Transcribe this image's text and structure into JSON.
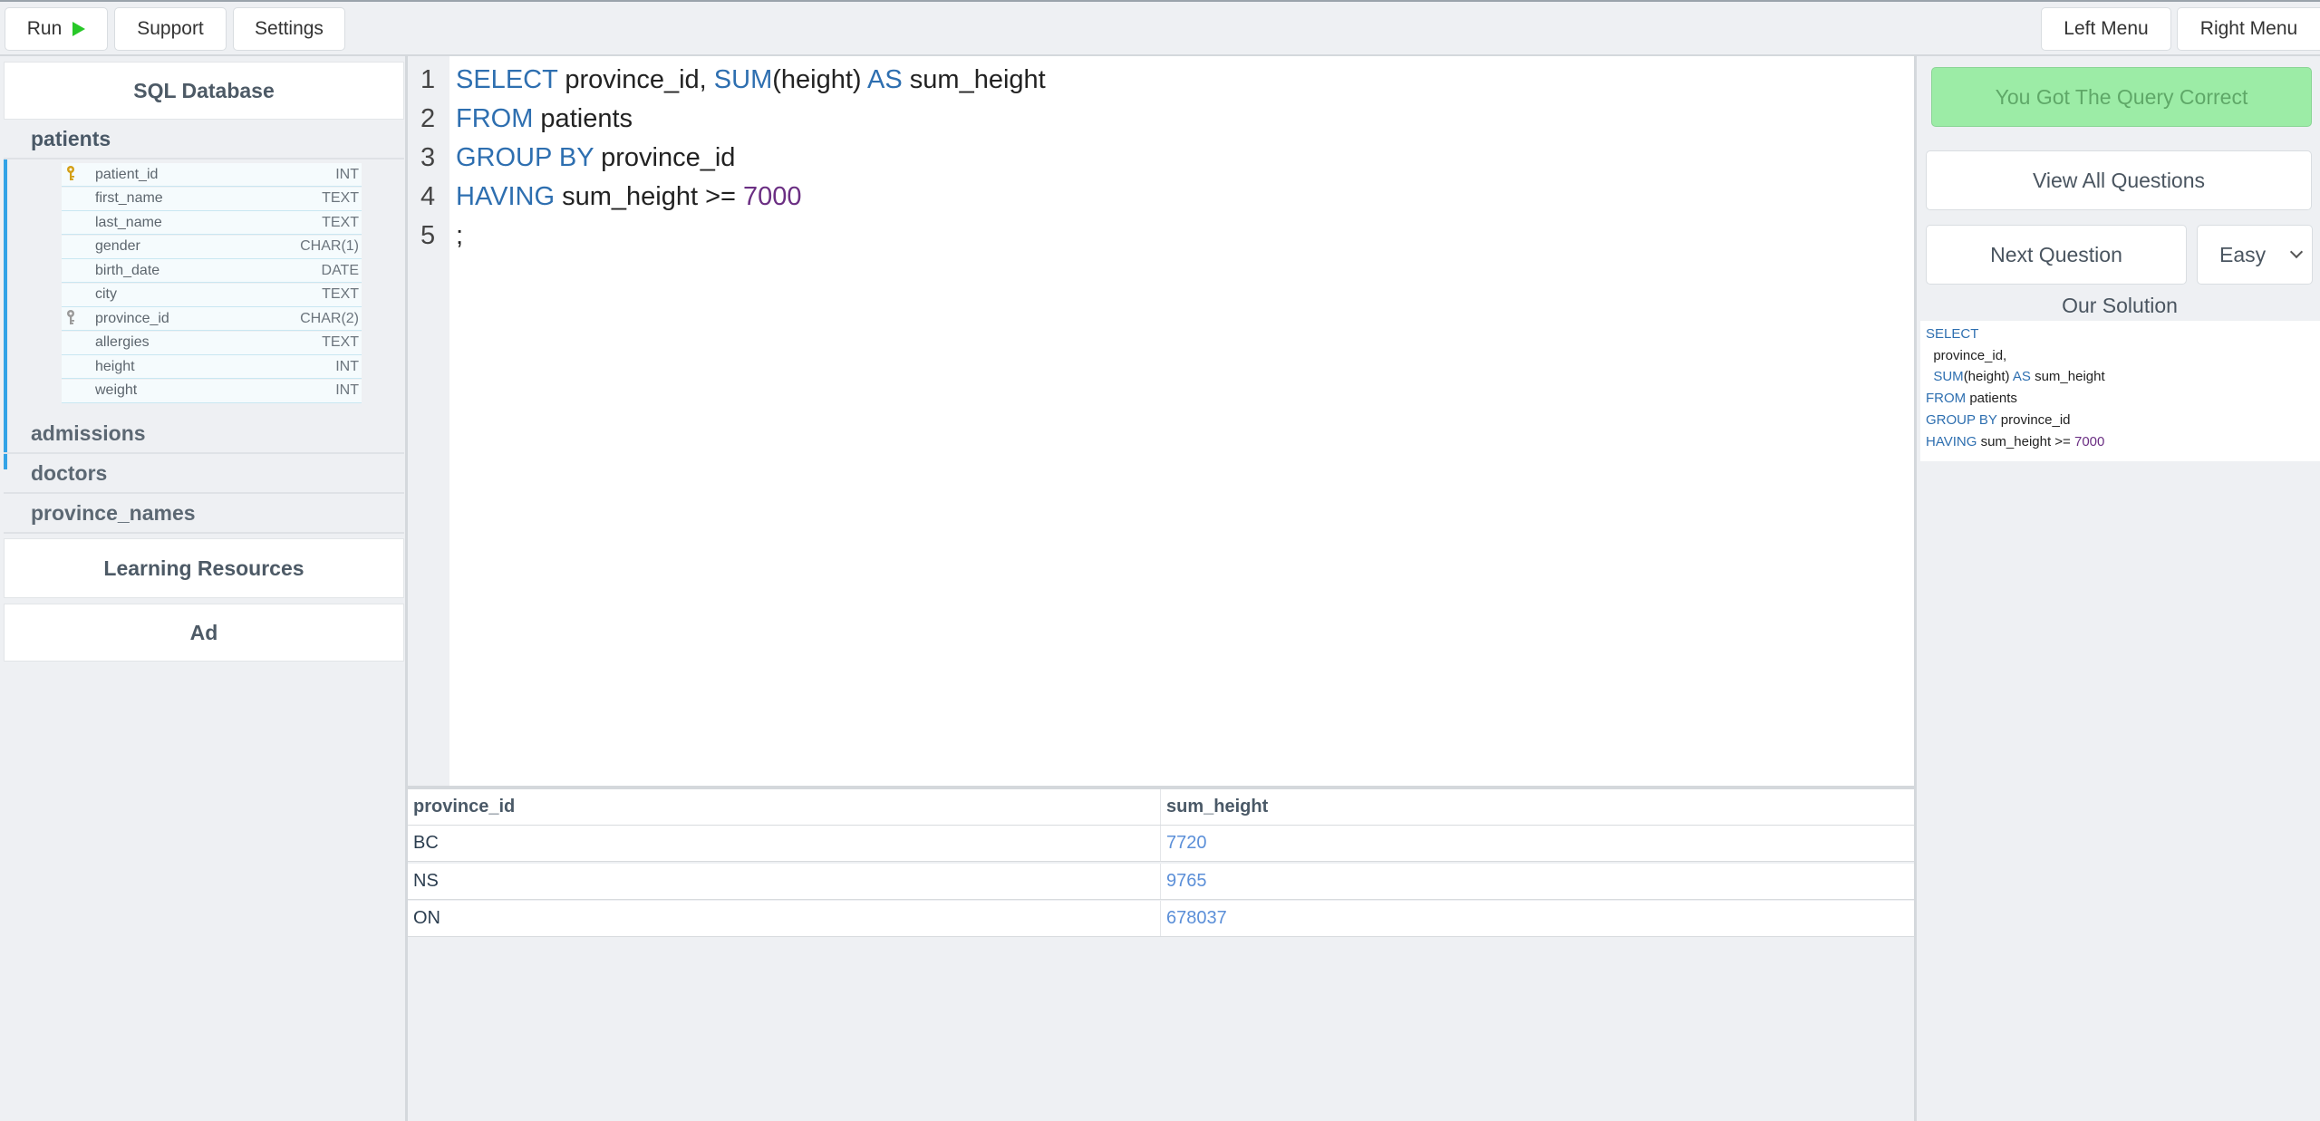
{
  "toolbar": {
    "run_label": "Run",
    "support_label": "Support",
    "settings_label": "Settings",
    "left_menu_label": "Left Menu",
    "right_menu_label": "Right Menu"
  },
  "sidebar": {
    "db_title": "SQL Database",
    "tables": [
      {
        "name": "patients",
        "open": true
      },
      {
        "name": "admissions",
        "open": false
      },
      {
        "name": "doctors",
        "open": false
      },
      {
        "name": "province_names",
        "open": false
      }
    ],
    "columns": [
      {
        "name": "patient_id",
        "type": "INT",
        "key": "primary"
      },
      {
        "name": "first_name",
        "type": "TEXT"
      },
      {
        "name": "last_name",
        "type": "TEXT"
      },
      {
        "name": "gender",
        "type": "CHAR(1)"
      },
      {
        "name": "birth_date",
        "type": "DATE"
      },
      {
        "name": "city",
        "type": "TEXT"
      },
      {
        "name": "province_id",
        "type": "CHAR(2)",
        "key": "foreign"
      },
      {
        "name": "allergies",
        "type": "TEXT"
      },
      {
        "name": "height",
        "type": "INT"
      },
      {
        "name": "weight",
        "type": "INT"
      }
    ],
    "learning_resources_label": "Learning Resources",
    "ad_label": "Ad"
  },
  "editor": {
    "line_numbers": [
      "1",
      "2",
      "3",
      "4",
      "5"
    ],
    "lines": [
      [
        {
          "t": "SELECT",
          "c": "kw"
        },
        {
          "t": " province_id, "
        },
        {
          "t": "SUM",
          "c": "kw"
        },
        {
          "t": "(height) "
        },
        {
          "t": "AS",
          "c": "kw"
        },
        {
          "t": " sum_height"
        }
      ],
      [
        {
          "t": "FROM",
          "c": "kw"
        },
        {
          "t": " patients"
        }
      ],
      [
        {
          "t": "GROUP BY",
          "c": "kw"
        },
        {
          "t": " province_id"
        }
      ],
      [
        {
          "t": "HAVING",
          "c": "kw"
        },
        {
          "t": " sum_height >= "
        },
        {
          "t": "7000",
          "c": "num"
        }
      ],
      [
        {
          "t": ";"
        }
      ]
    ]
  },
  "results": {
    "columns": [
      "province_id",
      "sum_height"
    ],
    "rows": [
      [
        "BC",
        "7720"
      ],
      [
        "NS",
        "9765"
      ],
      [
        "ON",
        "678037"
      ]
    ]
  },
  "right_panel": {
    "correct_label": "You Got The Query Correct",
    "view_all_label": "View All Questions",
    "next_label": "Next Question",
    "difficulty": "Easy",
    "solution_title": "Our Solution",
    "solution_lines": [
      [
        {
          "t": "SELECT",
          "c": "kw"
        }
      ],
      [
        {
          "t": "  province_id,"
        }
      ],
      [
        {
          "t": "  "
        },
        {
          "t": "SUM",
          "c": "kw"
        },
        {
          "t": "(height) "
        },
        {
          "t": "AS",
          "c": "kw"
        },
        {
          "t": " sum_height"
        }
      ],
      [
        {
          "t": "FROM",
          "c": "kw"
        },
        {
          "t": " patients"
        }
      ],
      [
        {
          "t": "GROUP BY",
          "c": "kw"
        },
        {
          "t": " province_id"
        }
      ],
      [
        {
          "t": "HAVING",
          "c": "kw"
        },
        {
          "t": " sum_height >= "
        },
        {
          "t": "7000",
          "c": "num"
        }
      ]
    ]
  },
  "colors": {
    "keyword": "#2e6fb0",
    "number": "#6b2f83",
    "accent": "#33a3e6",
    "correct_bg": "#9ceca6"
  }
}
